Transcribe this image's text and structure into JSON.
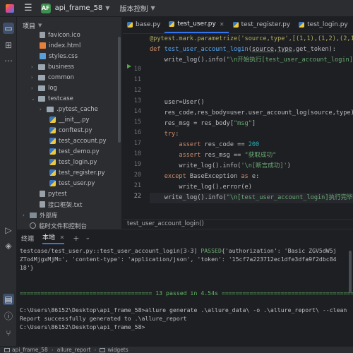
{
  "titlebar": {
    "menu_icon": "hamburger-menu-icon",
    "badge": "AF",
    "project": "api_frame_58",
    "vcs": "版本控制"
  },
  "left_strip": [
    "folder-icon",
    "plugins-icon",
    "more-icon",
    "run-icon",
    "layers-icon",
    "terminal-icon",
    "problems-icon",
    "git-icon"
  ],
  "project_panel": {
    "title": "项目",
    "items": [
      {
        "label": "favicon.ico",
        "icon": "file"
      },
      {
        "label": "index.html",
        "icon": "html"
      },
      {
        "label": "styles.css",
        "icon": "css"
      },
      {
        "label": "business",
        "icon": "folder"
      },
      {
        "label": "common",
        "icon": "folder"
      },
      {
        "label": "log",
        "icon": "folder"
      },
      {
        "label": "testcase",
        "icon": "folder"
      },
      {
        "label": ".pytest_cache",
        "icon": "folder"
      },
      {
        "label": "__init__.py",
        "icon": "py"
      },
      {
        "label": "conftest.py",
        "icon": "py"
      },
      {
        "label": "test_account.py",
        "icon": "py"
      },
      {
        "label": "test_demo.py",
        "icon": "py"
      },
      {
        "label": "test_login.py",
        "icon": "py"
      },
      {
        "label": "test_register.py",
        "icon": "py"
      },
      {
        "label": "test_user.py",
        "icon": "py"
      },
      {
        "label": "pytest",
        "icon": "txt"
      },
      {
        "label": "接口框架.txt",
        "icon": "txt"
      },
      {
        "label": "外部库",
        "icon": "lib"
      },
      {
        "label": "临时文件和控制台",
        "icon": "scratch"
      }
    ]
  },
  "editor": {
    "tabs": [
      {
        "label": "base.py",
        "active": false
      },
      {
        "label": "test_user.py",
        "active": true
      },
      {
        "label": "test_register.py",
        "active": false
      },
      {
        "label": "test_login.py",
        "active": false
      }
    ],
    "line_numbers": [
      "",
      "",
      "",
      "10",
      "11",
      "12",
      "13",
      "14",
      "15",
      "16",
      "17",
      "18",
      "19",
      "20",
      "21",
      "22",
      "",
      ""
    ],
    "code_lines": [
      "@pytest.mark.parametrize('source,type',[(1,1),(1,2),(2,1),(",
      "def test_user_account_login(source,type,get_token):",
      "    write_log().info(\"\\n开始执行[test_user_account_login]\")",
      "",
      "",
      "",
      "    user=User()",
      "    res_code,res_body=user.user_account_log(source,type)",
      "    res_msg = res_body[\"msg\"]",
      "    try:",
      "        assert res_code == 200",
      "        assert res_msg == \"获取成功\"",
      "        write_log().info('\\n[断言成功]')",
      "    except BaseException as e:",
      "        write_log().error(e)",
      "    write_log().info(\"\\n[test_user_account_login]执行完毕\")"
    ],
    "breadcrumb": "test_user_account_login()"
  },
  "terminal": {
    "tabs": [
      {
        "label": "终端",
        "active": false
      },
      {
        "label": "本地",
        "active": true
      }
    ],
    "lines": [
      "testcase/test_user.py::test_user_account_login[3-3] PASSED{'authorization': 'Basic ZGV5dW5j",
      "ZTo4MjgxMjM=', 'content-type': 'application/json', 'token': '15cf7a223712ec1dfe3dfa9f2dbc84",
      "18'}",
      "",
      "",
      "====================================== 13 passed in 4.54s ======================================",
      "",
      "C:\\Users\\86152\\Desktop\\api_frame_58>allure generate .\\allure_data\\ -o .\\allure_report\\ --clean",
      "Report successfully generated to .\\allure_report",
      "C:\\Users\\86152\\Desktop\\api_frame_58>"
    ]
  },
  "statusbar": {
    "items": [
      "api_frame_58",
      "allure_report",
      "widgets"
    ]
  },
  "colors": {
    "accent": "#3574f0",
    "pass": "#6aab73",
    "keyword": "#cf8e6d",
    "function": "#56a8f5",
    "string": "#6aab73",
    "number": "#2aacb8"
  }
}
